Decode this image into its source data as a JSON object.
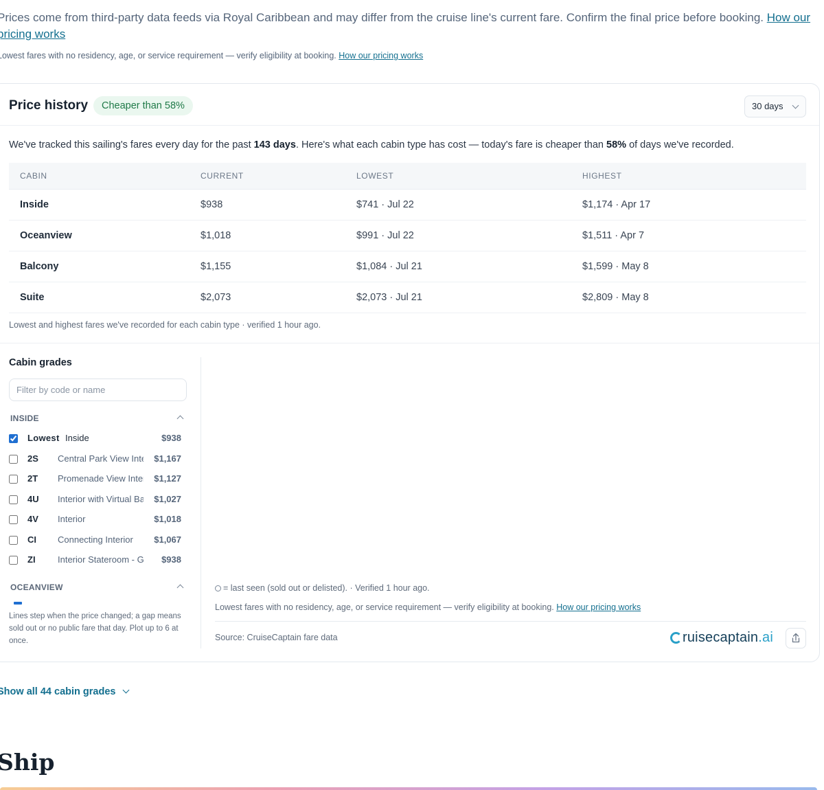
{
  "disclaimer": {
    "main_text": "Prices come from third-party data feeds via Royal Caribbean and may differ from the cruise line's current fare. Confirm the final price before booking.",
    "main_link": "How our pricing works",
    "small_text": "Lowest fares with no residency, age, or service requirement — verify eligibility at booking.",
    "small_link": "How our pricing works"
  },
  "price_history": {
    "title": "Price history",
    "badge": "Cheaper than 58%",
    "range_select": "30 days",
    "tracked_prefix": "We've tracked this sailing's fares every day for the past",
    "tracked_days": "143 days",
    "tracked_middle": ". Here's what each cabin type has cost — today's fare is cheaper than",
    "tracked_pct": "58%",
    "tracked_suffix": "of days we've recorded.",
    "table": {
      "headers": [
        "CABIN",
        "CURRENT",
        "LOWEST",
        "HIGHEST"
      ],
      "rows": [
        {
          "cabin": "Inside",
          "current": "$938",
          "lowest": "$741 · Jul 22",
          "highest": "$1,174 · Apr 17"
        },
        {
          "cabin": "Oceanview",
          "current": "$1,018",
          "lowest": "$991 · Jul 22",
          "highest": "$1,511 · Apr 7"
        },
        {
          "cabin": "Balcony",
          "current": "$1,155",
          "lowest": "$1,084 · Jul 21",
          "highest": "$1,599 · May 8"
        },
        {
          "cabin": "Suite",
          "current": "$2,073",
          "lowest": "$2,073 · Jul 21",
          "highest": "$2,809 · May 8"
        }
      ]
    },
    "table_note": "Lowest and highest fares we've recorded for each cabin type · verified 1 hour ago."
  },
  "cabin_grades": {
    "title": "Cabin grades",
    "filter_placeholder": "Filter by code or name",
    "groups": [
      {
        "name": "INSIDE",
        "items": [
          {
            "code": "Lowest",
            "desc": "Inside",
            "price": "$938",
            "checked": true
          },
          {
            "code": "2S",
            "desc": "Central Park View Interior",
            "price": "$1,167",
            "checked": false
          },
          {
            "code": "2T",
            "desc": "Promenade View Interior",
            "price": "$1,127",
            "checked": false
          },
          {
            "code": "4U",
            "desc": "Interior with Virtual Balcony",
            "price": "$1,027",
            "checked": false
          },
          {
            "code": "4V",
            "desc": "Interior",
            "price": "$1,018",
            "checked": false
          },
          {
            "code": "CI",
            "desc": "Connecting Interior",
            "price": "$1,067",
            "checked": false
          },
          {
            "code": "ZI",
            "desc": "Interior Stateroom - Guarantee",
            "price": "$938",
            "checked": false
          }
        ]
      },
      {
        "name": "OCEANVIEW",
        "items": []
      }
    ],
    "footnote": "Lines step when the price changed; a gap means sold out or no public fare that day. Plot up to 6 at once."
  },
  "chart_footer": {
    "legend_note": "= last seen (sold out or delisted). · Verified 1 hour ago.",
    "disclaimer_text": "Lowest fares with no residency, age, or service requirement — verify eligibility at booking.",
    "disclaimer_link": "How our pricing works",
    "source": "Source: CruiseCaptain fare data",
    "brand_name": "ruisecaptain",
    "brand_tld": ".ai",
    "share_icon": "share-icon"
  },
  "show_all": "Show all 44 cabin grades",
  "section_heading": "Ship",
  "colors": {
    "accent": "#136f8f",
    "badge_bg": "#eaf7ef",
    "badge_text": "#1f7a48",
    "checkbox": "#1f6fd1",
    "brand_teal": "#2aa0c8"
  }
}
